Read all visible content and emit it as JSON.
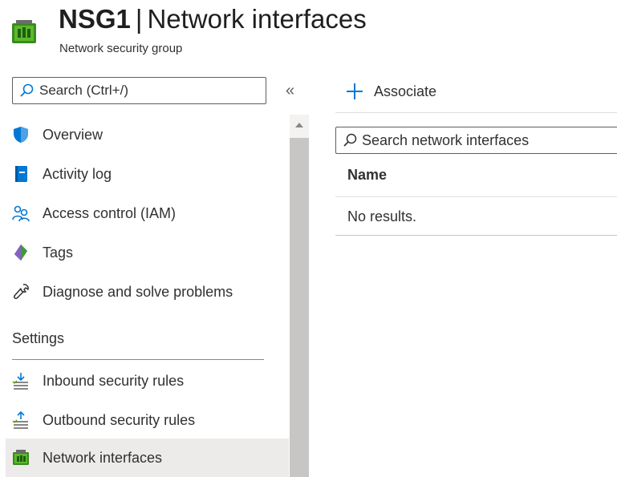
{
  "header": {
    "resource_name": "NSG1",
    "separator": "|",
    "page_name": "Network interfaces",
    "resource_type": "Network security group"
  },
  "sidebar": {
    "search_placeholder": "Search (Ctrl+/)",
    "collapse_glyph": "«",
    "items": [
      {
        "label": "Overview",
        "icon": "shield-icon"
      },
      {
        "label": "Activity log",
        "icon": "activity-log-icon"
      },
      {
        "label": "Access control (IAM)",
        "icon": "people-icon"
      },
      {
        "label": "Tags",
        "icon": "tag-icon"
      },
      {
        "label": "Diagnose and solve problems",
        "icon": "wrench-icon"
      }
    ],
    "section_settings": "Settings",
    "settings_items": [
      {
        "label": "Inbound security rules",
        "icon": "inbound-rules-icon"
      },
      {
        "label": "Outbound security rules",
        "icon": "outbound-rules-icon"
      },
      {
        "label": "Network interfaces",
        "icon": "network-interface-icon",
        "selected": true
      }
    ]
  },
  "toolbar": {
    "associate_label": "Associate"
  },
  "content": {
    "search_placeholder": "Search network interfaces",
    "table": {
      "columns": [
        "Name"
      ],
      "empty_text": "No results."
    }
  },
  "colors": {
    "accent": "#0078d4",
    "selected_bg": "#edebe9",
    "text": "#323130"
  }
}
